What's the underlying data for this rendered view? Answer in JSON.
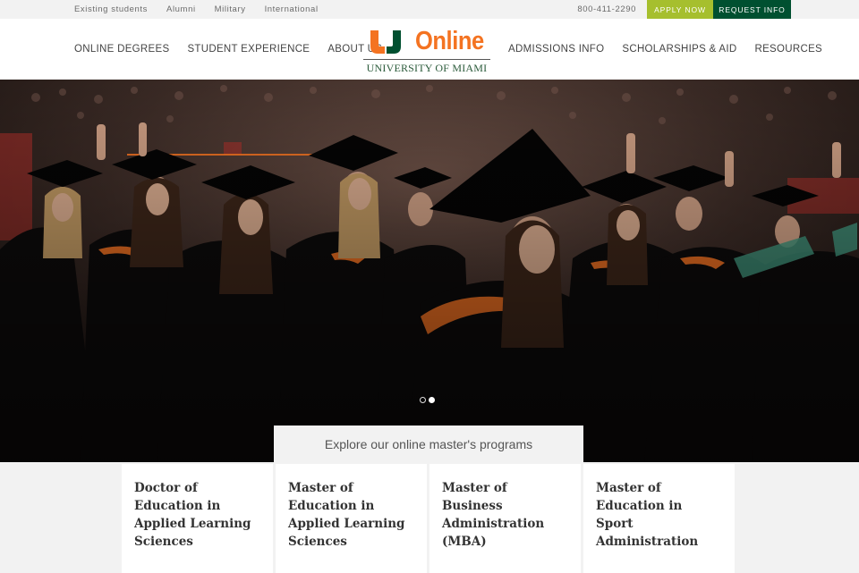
{
  "utility": {
    "links": [
      "Existing students",
      "Alumni",
      "Military",
      "International"
    ],
    "phone": "800-411-2290",
    "apply_label": "APPLY NOW",
    "request_label": "REQUEST INFO",
    "colors": {
      "apply": "#a6bf2e",
      "request": "#005030"
    }
  },
  "header": {
    "nav_left": [
      "ONLINE DEGREES",
      "STUDENT EXPERIENCE",
      "ABOUT US"
    ],
    "nav_right": [
      "ADMISSIONS INFO",
      "SCHOLARSHIPS & AID",
      "RESOURCES"
    ],
    "logo": {
      "word": "Online",
      "university": "UNIVERSITY OF MIAMI",
      "colors": {
        "orange": "#f47321",
        "green": "#005030"
      }
    }
  },
  "hero": {
    "image": "graduation-ceremony-photo",
    "slides": {
      "count": 2,
      "active": 2
    },
    "explore_label": "Explore our online master's programs"
  },
  "programs": [
    {
      "title": "Doctor of Education in Applied Learning Sciences"
    },
    {
      "title": "Master of Education in Applied Learning Sciences"
    },
    {
      "title": "Master of Business Administration (MBA)"
    },
    {
      "title": "Master of Education in Sport Administration"
    }
  ]
}
